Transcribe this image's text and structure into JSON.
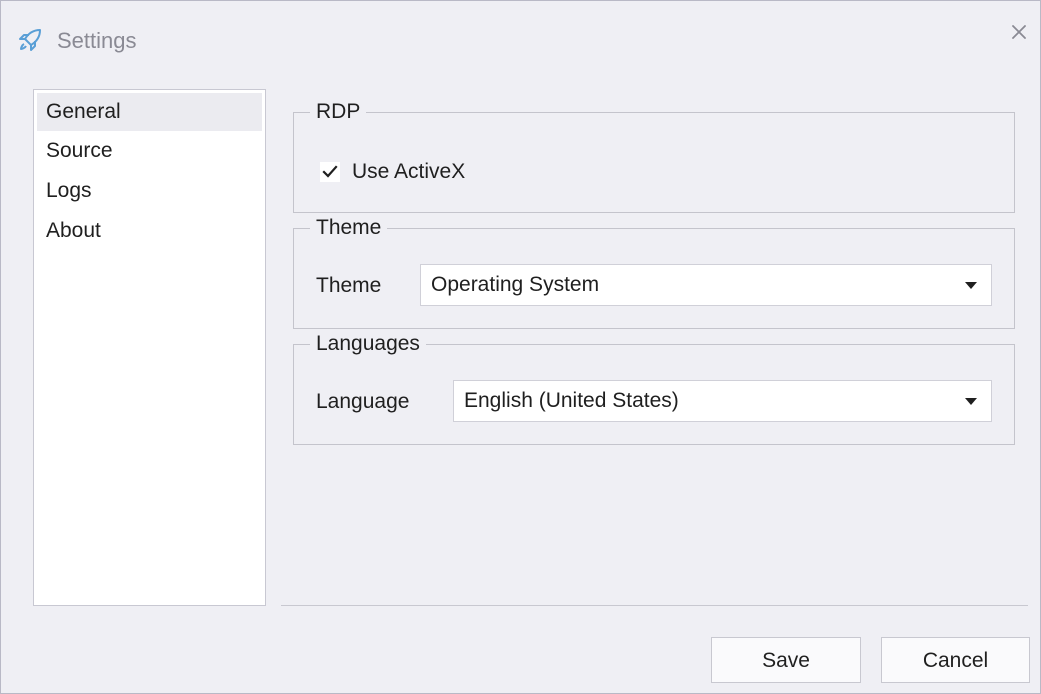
{
  "window": {
    "title": "Settings",
    "accent_color": "#5a9fd6"
  },
  "sidebar": {
    "items": [
      {
        "label": "General",
        "selected": true
      },
      {
        "label": "Source",
        "selected": false
      },
      {
        "label": "Logs",
        "selected": false
      },
      {
        "label": "About",
        "selected": false
      }
    ]
  },
  "rdp": {
    "group_title": "RDP",
    "use_activex_label": "Use ActiveX",
    "use_activex_checked": true
  },
  "theme": {
    "group_title": "Theme",
    "field_label": "Theme",
    "selected_value": "Operating System"
  },
  "languages": {
    "group_title": "Languages",
    "field_label": "Language",
    "selected_value": "English (United States)"
  },
  "footer": {
    "save_label": "Save",
    "cancel_label": "Cancel"
  },
  "icons": {
    "app": "rocket-icon",
    "close": "close-icon",
    "check": "checkmark-icon",
    "dropdown": "caret-down-icon"
  }
}
